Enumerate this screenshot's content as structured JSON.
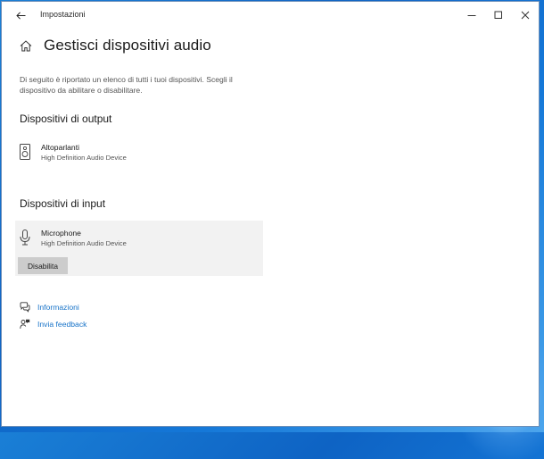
{
  "window": {
    "app_title": "Impostazioni"
  },
  "page": {
    "title": "Gestisci dispositivi audio",
    "description": "Di seguito è riportato un elenco di tutti i tuoi dispositivi. Scegli il dispositivo da abilitare o disabilitare."
  },
  "output": {
    "section_title": "Dispositivi di output",
    "devices": [
      {
        "name": "Altoparlanti",
        "subtitle": "High Definition Audio Device",
        "icon": "speaker-icon"
      }
    ]
  },
  "input": {
    "section_title": "Dispositivi di input",
    "devices": [
      {
        "name": "Microphone",
        "subtitle": "High Definition Audio Device",
        "icon": "microphone-icon",
        "button_label": "Disabilita"
      }
    ]
  },
  "links": [
    {
      "label": "Informazioni",
      "icon": "help-chat-icon"
    },
    {
      "label": "Invia feedback",
      "icon": "feedback-icon"
    }
  ],
  "colors": {
    "link": "#1672c8",
    "panel": "#f2f2f2",
    "button": "#cccccc",
    "desktop": "#0e63c4"
  }
}
